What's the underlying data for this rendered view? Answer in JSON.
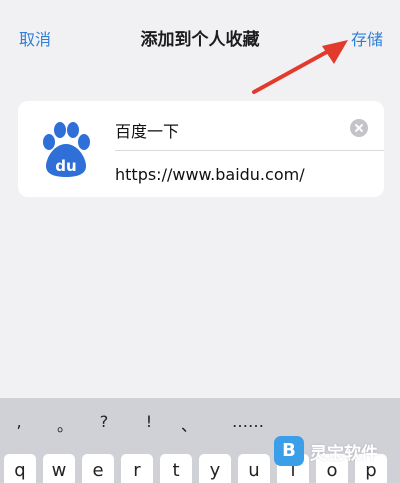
{
  "nav": {
    "cancel_label": "取消",
    "title": "添加到个人收藏",
    "save_label": "存储"
  },
  "bookmark": {
    "name": "百度一下",
    "url": "https://www.baidu.com/",
    "logo_text": "du"
  },
  "keyboard": {
    "punctuation": [
      ",",
      "。",
      "?",
      "!",
      "、",
      "……"
    ],
    "letters_visible": [
      "q",
      "w",
      "e",
      "r",
      "t",
      "y",
      "u",
      "i",
      "o",
      "p"
    ]
  },
  "watermark": {
    "icon_text": "B",
    "text": "灵宝软件"
  },
  "colors": {
    "accent": "#2f7fd8",
    "baidu_blue": "#2f6fd8",
    "annotation_arrow": "#e23a2c"
  }
}
